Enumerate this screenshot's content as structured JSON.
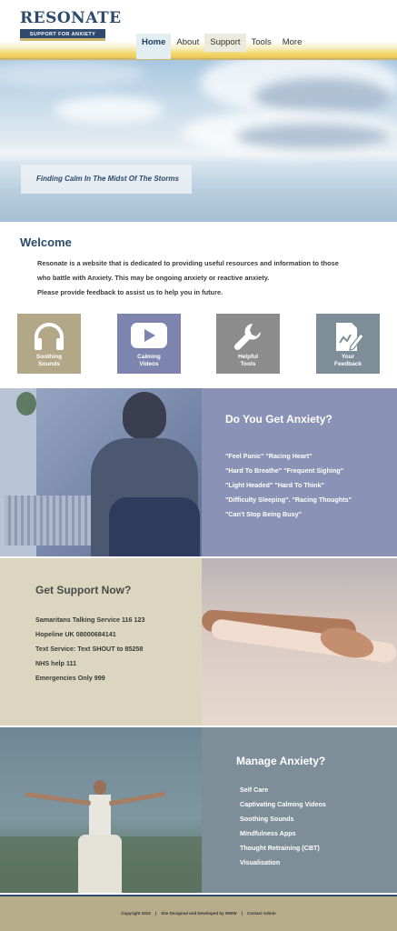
{
  "header": {
    "logo_title": "RESONATE",
    "logo_subtitle": "SUPPORT FOR ANXIETY",
    "nav": [
      "Home",
      "About",
      "Support",
      "Tools",
      "More"
    ]
  },
  "hero": {
    "caption": "Finding Calm In The Midst Of The Storms"
  },
  "welcome": {
    "title": "Welcome",
    "line1": "Resonate is a website that is dedicated to providing useful resources and information to those",
    "line2": "who battle with Anxiety. This may be ongoing anxiety or reactive anxiety.",
    "line3": "Please provide feedback to assist us to help you in future."
  },
  "tiles": [
    {
      "line1": "Soothing",
      "line2": "Sounds",
      "icon": "headphones-icon",
      "color": "#b2a786"
    },
    {
      "line1": "Calming",
      "line2": "Videos",
      "icon": "play-icon",
      "color": "#7d84ad"
    },
    {
      "line1": "Helpful",
      "line2": "Tools",
      "icon": "wrench-icon",
      "color": "#8c8c8c"
    },
    {
      "line1": "Your",
      "line2": "Feedback",
      "icon": "feedback-icon",
      "color": "#7e8e98"
    }
  ],
  "anxiety": {
    "title": "Do You Get Anxiety?",
    "lines": [
      "\"Feel Panic\"  \"Racing Heart\"",
      "\"Hard To Breathe\"  \"Frequent Sighing\"",
      "\"Light Headed\"  \"Hard To Think\"",
      "\"Difficulty Sleeping\". \"Racing Thoughts\"",
      "\"Can't Stop Being Busy\""
    ]
  },
  "support": {
    "title": "Get Support Now?",
    "lines": [
      "Samaritans Talking Service 116 123",
      "Hopeline UK 08000684141",
      "Text Service: Text SHOUT to 85258",
      "NHS help 111",
      "Emergencies Only 999"
    ]
  },
  "manage": {
    "title": "Manage Anxiety?",
    "lines": [
      "Self Care",
      "Captivating Calming Videos",
      "Soothing Sounds",
      "Mindfulness Apps",
      "Thought Retraining (CBT)",
      "Visualisation"
    ]
  },
  "footer": {
    "copyright": "Copyright 2023",
    "sep1": "|",
    "designed": "Site Designed and Developed by WWW",
    "sep2": "|",
    "contact": "Contact Admin"
  },
  "colors": {
    "brand": "#2c4a6b",
    "anxiety_panel": "#8a93b5",
    "support_panel": "#dcd6c0",
    "manage_panel": "#7e8e98",
    "footer": "#b8ad8a"
  }
}
